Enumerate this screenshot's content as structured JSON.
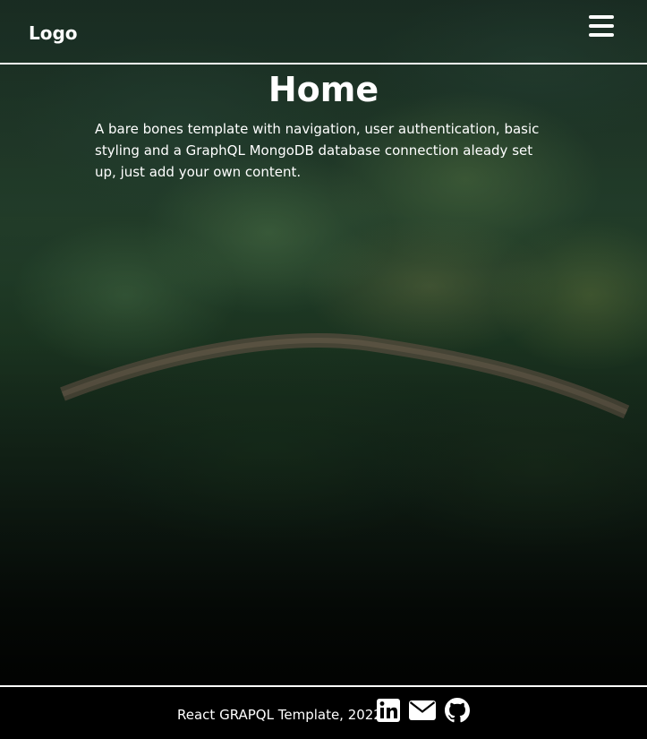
{
  "navbar": {
    "logo": "Logo",
    "menu_icon": "hamburger-menu-icon"
  },
  "main": {
    "title": "Home",
    "description": "A bare bones template with navigation, user authentication, basic styling and a GraphQL MongoDB database connection aleady set up, just add your own content."
  },
  "footer": {
    "text": "React GRAPQL Template, 2022",
    "icons": [
      "linkedin-icon",
      "email-icon",
      "github-icon"
    ]
  },
  "colors": {
    "text": "#ffffff",
    "footer_background": "#000000",
    "divider": "#ffffff"
  }
}
